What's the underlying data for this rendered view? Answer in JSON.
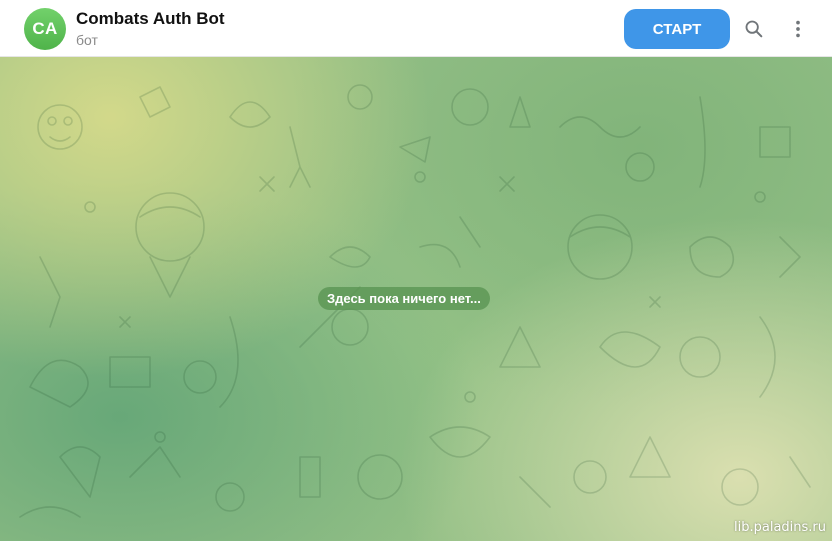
{
  "header": {
    "avatar_initials": "CA",
    "title": "Combats Auth Bot",
    "subtitle": "бот",
    "start_label": "СТАРТ",
    "search_icon": "search-icon",
    "more_icon": "more-vertical-icon"
  },
  "chat": {
    "empty_text": "Здесь пока ничего нет..."
  },
  "watermark": "lib.paladins.ru",
  "colors": {
    "accent": "#3f96e8",
    "avatar": "#5cc254",
    "pill": "#5c9654"
  }
}
